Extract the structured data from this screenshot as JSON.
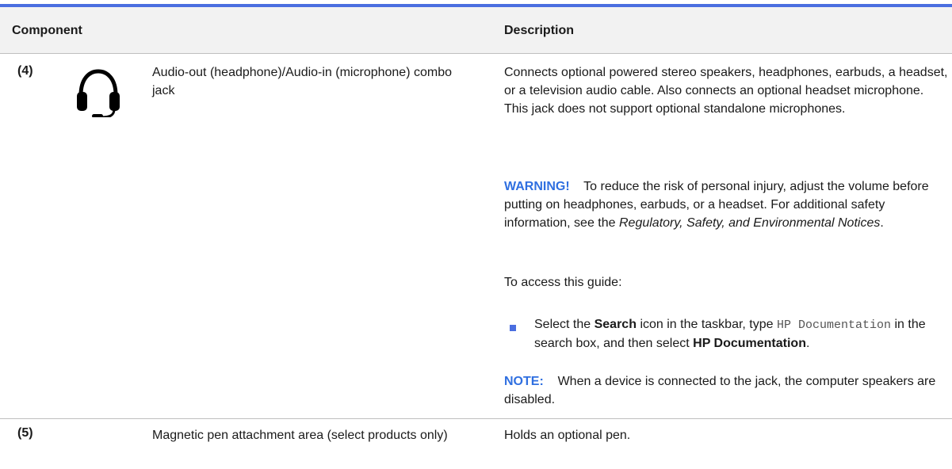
{
  "header": {
    "component": "Component",
    "description": "Description"
  },
  "row4": {
    "number": "(4)",
    "icon": "headset-icon",
    "name": "Audio-out (headphone)/Audio-in (microphone) combo jack",
    "desc_p1": "Connects optional powered stereo speakers, headphones, earbuds, a headset, or a television audio cable. Also connects an optional headset microphone. This jack does not support optional standalone microphones.",
    "warning_label": "WARNING!",
    "warning_text": "To reduce the risk of personal injury, adjust the volume before putting on headphones, earbuds, or a headset. For additional safety information, see the",
    "warning_doc": "Regulatory, Safety, and Environmental Notices",
    "warning_end": ".",
    "access": "To access this guide:",
    "bullet_1": "Select the",
    "bullet_search": "Search",
    "bullet_2": "icon in the taskbar, type",
    "bullet_code": "HP Documentation",
    "bullet_3": "in the search box, and then select",
    "bullet_hp": "HP Documentation",
    "bullet_end": ".",
    "note_label": "NOTE:",
    "note_text": "When a device is connected to the jack, the computer speakers are disabled."
  },
  "row5": {
    "number": "(5)",
    "name": "Magnetic pen attachment area (select products only)",
    "desc": "Holds an optional pen."
  },
  "colors": {
    "accent": "#4a6ee0",
    "label_blue": "#2f6fe0",
    "header_bg": "#f2f2f2"
  }
}
